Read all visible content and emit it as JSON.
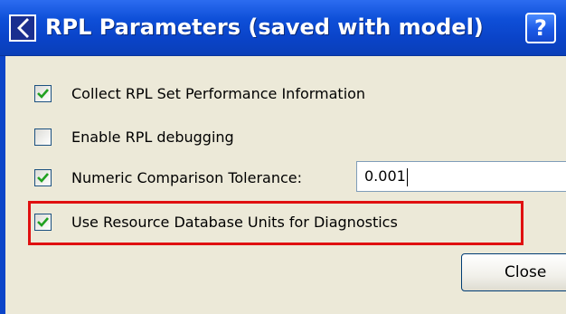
{
  "window": {
    "title": "RPL Parameters (saved with model)",
    "help_label": "?"
  },
  "options": [
    {
      "label": "Collect RPL Set Performance Information",
      "checked": true
    },
    {
      "label": "Enable RPL debugging",
      "checked": false
    },
    {
      "label": "Numeric Comparison Tolerance:",
      "checked": true
    },
    {
      "label": "Use Resource Database Units for Diagnostics",
      "checked": true
    }
  ],
  "tolerance_value": "0.001",
  "buttons": {
    "close_label": "Close"
  },
  "colors": {
    "title_bar": "#0a43c8",
    "highlight_box": "#e01010",
    "check_mark": "#21a121"
  },
  "icons": [
    "app-icon",
    "help-icon",
    "check-icon"
  ]
}
